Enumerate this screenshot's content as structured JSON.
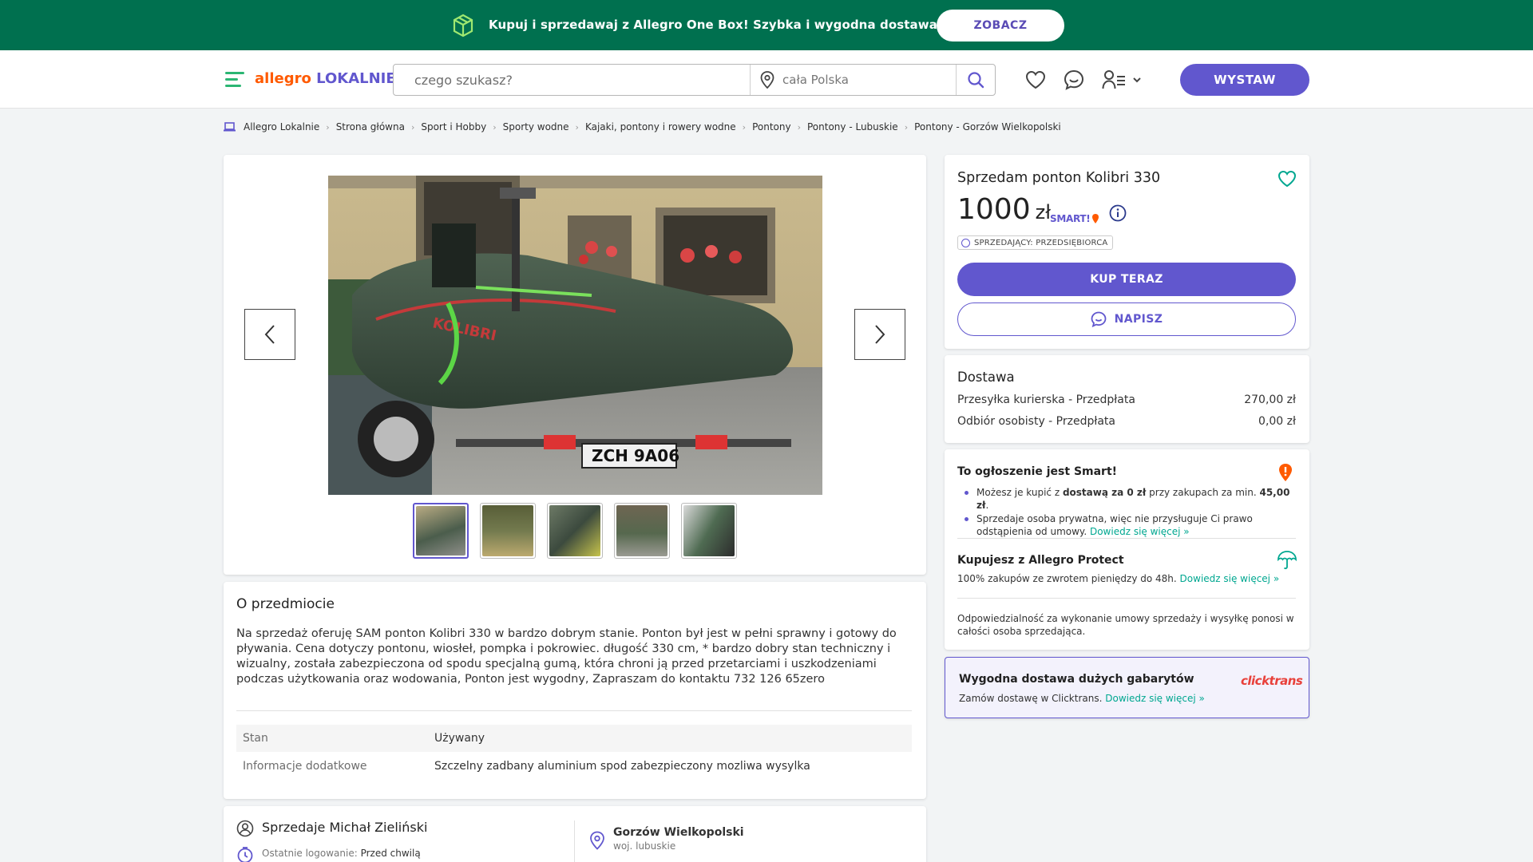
{
  "banner": {
    "text": "Kupuj i sprzedawaj z Allegro One Box! Szybka i wygodna dostawa blisko Ciebie",
    "button": "ZOBACZ"
  },
  "header": {
    "logo_part1": "allegro",
    "logo_part2": "LOKALNIE",
    "search_placeholder": "czego szukasz?",
    "location_placeholder": "cała Polska",
    "sell_button": "WYSTAW"
  },
  "breadcrumbs": [
    "Allegro Lokalnie",
    "Strona główna",
    "Sport i Hobby",
    "Sporty wodne",
    "Kajaki, pontony i rowery wodne",
    "Pontony",
    "Pontony - Lubuskie",
    "Pontony - Gorzów Wielkopolski"
  ],
  "offer": {
    "title": "Sprzedam ponton Kolibri 330",
    "price": "1000",
    "currency": "zł",
    "smart_label": "SMART!",
    "seller_badge": "SPRZEDAJĄCY: PRZEDSIĘBIORCA",
    "buy_button": "KUP TERAZ",
    "message_button": "NAPISZ",
    "photo_plate": "ZCH 9A06"
  },
  "delivery": {
    "heading": "Dostawa",
    "options": [
      {
        "name": "Przesyłka kurierska - Przedpłata",
        "price": "270,00 zł"
      },
      {
        "name": "Odbiór osobisty - Przedpłata",
        "price": "0,00 zł"
      }
    ]
  },
  "smart_info": {
    "heading": "To ogłoszenie jest Smart!",
    "bullet1_pre": "Możesz je kupić z ",
    "bullet1_bold": "dostawą za 0 zł",
    "bullet1_mid": " przy zakupach za min. ",
    "bullet1_amount": "45,00 zł",
    "bullet1_end": ".",
    "bullet2": "Sprzedaje osoba prywatna, więc nie przysługuje Ci prawo odstąpienia od umowy.",
    "link": "Dowiedz się więcej »",
    "protect_heading": "Kupujesz z Allegro Protect",
    "protect_text": "100% zakupów ze zwrotem pieniędzy do 48h.",
    "responsibility": "Odpowiedzialność za wykonanie umowy sprzedaży i wysyłkę ponosi w całości osoba sprzedająca."
  },
  "clicktrans": {
    "heading": "Wygodna dostawa dużych gabarytów",
    "logo": "clicktrans",
    "text": "Zamów dostawę w Clicktrans.",
    "link": "Dowiedz się więcej »"
  },
  "about": {
    "heading": "O przedmiocie",
    "description": "Na sprzedaż oferuję SAM ponton Kolibri 330 w bardzo dobrym stanie. Ponton był jest w pełni sprawny i gotowy do pływania. Cena dotyczy pontonu, wiosłeł, pompka i pokrowiec. długość 330 cm, * bardzo dobry stan techniczny i wizualny, została zabezpieczona od spodu specjalną gumą, która chroni ją przed przetarciami i uszkodzeniami podczas użytkowania oraz wodowania, Ponton jest wygodny, Zapraszam do kontaktu 732 126 65zero",
    "params": [
      {
        "key": "Stan",
        "value": "Używany"
      },
      {
        "key": "Informacje dodatkowe",
        "value": "Szczelny zadbany aluminium spod zabezpieczony mozliwa wysylka"
      }
    ]
  },
  "seller": {
    "name": "Sprzedaje Michał Zieliński",
    "login_label": "Ostatnie logowanie:",
    "login_value": "Przed chwilą",
    "city": "Gorzów Wielkopolski",
    "region": "woj. lubuskie"
  },
  "colors": {
    "banner_green": "#00704f",
    "accent_purple": "#6157ce",
    "link_teal": "#00a790",
    "smart_orange": "#ff5a00"
  }
}
